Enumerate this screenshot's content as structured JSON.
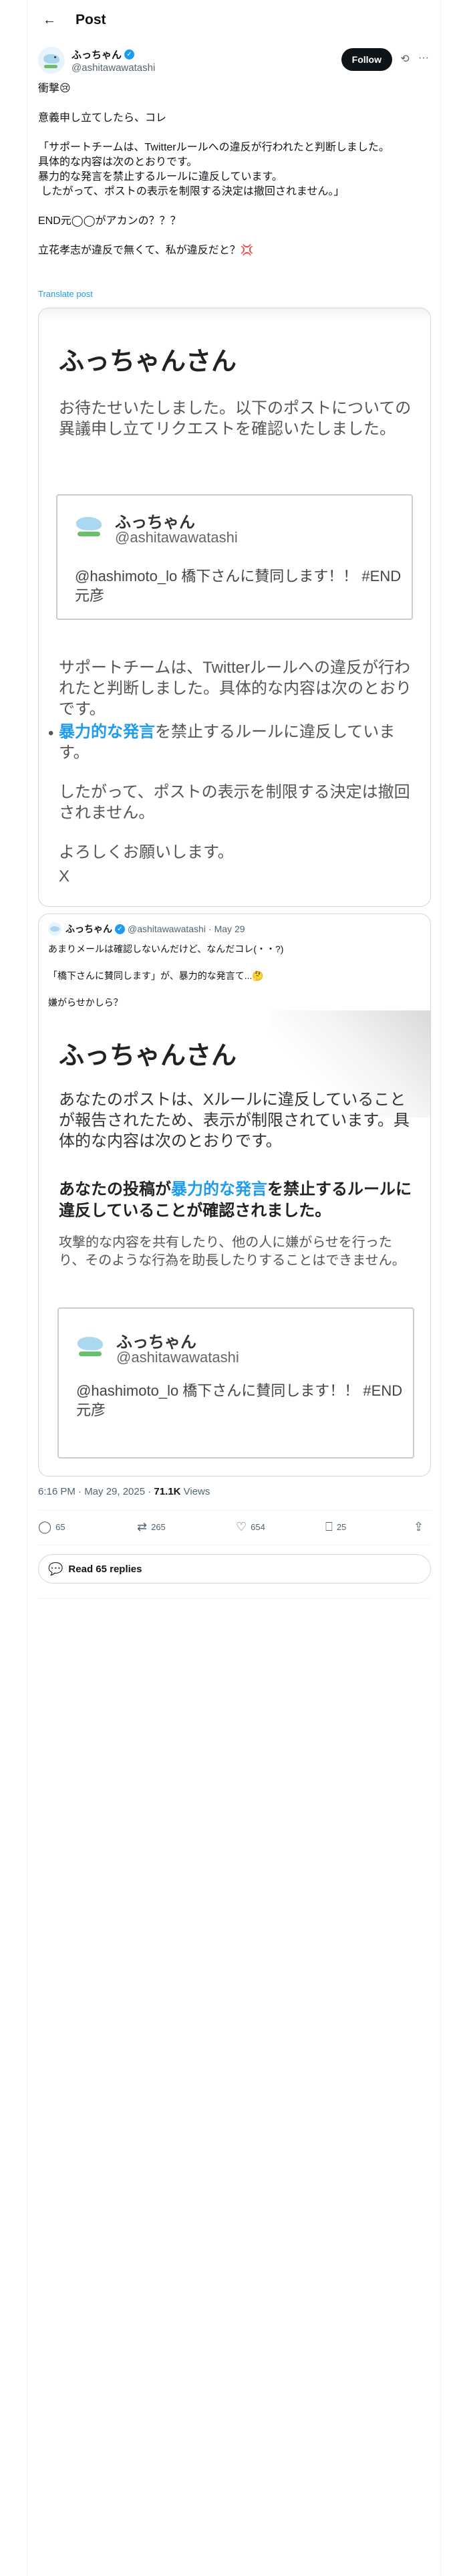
{
  "header": {
    "back_icon": "←",
    "title": "Post"
  },
  "author": {
    "name": "ふっちゃん",
    "handle": "@ashitawawatashi",
    "follow_label": "Follow",
    "grok_icon": "⟲",
    "more_icon": "···"
  },
  "post": {
    "lines": [
      "衝撃😢",
      "",
      "意義申し立てしたら、コレ",
      "",
      "「サポートチームは、Twitterルールへの違反が行われたと判断しました。",
      "具体的な内容は次のとおりです。",
      "暴力的な発言を禁止するルールに違反しています。",
      " したがって、ポストの表示を制限する決定は撤回されません。」",
      "",
      "END元◯◯がアカンの？？？",
      "",
      "立花孝志が違反で無くて、私が違反だと？💢"
    ],
    "translate": "Translate post"
  },
  "card1": {
    "title": "ふっちゃんさん",
    "intro": "お待たせいたしました。以下のポストについての異議申し立てリクエストを確認いたしました。",
    "quote_name": "ふっちゃん",
    "quote_handle": "@ashitawawatashi",
    "quote_text": "@hashimoto_lo 橋下さんに賛同します！！ #END元彦",
    "support": "サポートチームは、Twitterルールへの違反が行われたと判断しました。具体的な内容は次のとおりです。",
    "bullet_blue": "暴力的な発言",
    "bullet_rest": "を禁止するルールに違反しています。",
    "decision": "したがって、ポストの表示を制限する決定は撤回されません。",
    "regards": "よろしくお願いします。",
    "sign": "X"
  },
  "card2": {
    "name": "ふっちゃん",
    "handle": "@ashitawawatashi",
    "date": "May 29",
    "text1": "あまりメールは確認しないんだけど、なんだコレ(・・?)",
    "text2": "「橋下さんに賛同します」が、暴力的な発言て...🤔",
    "text3": "嫌がらせかしら？",
    "title": "ふっちゃんさん",
    "notice": "あなたのポストは、Xルールに違反していることが報告されたため、表示が制限されています。具体的な内容は次のとおりです。",
    "bold_a": "あなたの投稿が",
    "bold_blue": "暴力的な発言",
    "bold_b": "を禁止するルールに違反していることが確認されました。",
    "desc": "攻撃的な内容を共有したり、他の人に嫌がらせを行ったり、そのような行為を助長したりすることはできません。",
    "quote_name": "ふっちゃん",
    "quote_handle": "@ashitawawatashi",
    "quote_text": "@hashimoto_lo 橋下さんに賛同します！！ #END元彦"
  },
  "meta": {
    "time": "6:16 PM · May 29, 2025 · ",
    "views": "71.1K",
    "views_label": " Views"
  },
  "actions": {
    "replies": "65",
    "reposts": "265",
    "likes": "654",
    "bookmarks": "25"
  },
  "read_replies": "Read 65 replies",
  "colors": {
    "accent": "#1d9bf0",
    "text": "#0f1419",
    "secondary": "#536471"
  }
}
